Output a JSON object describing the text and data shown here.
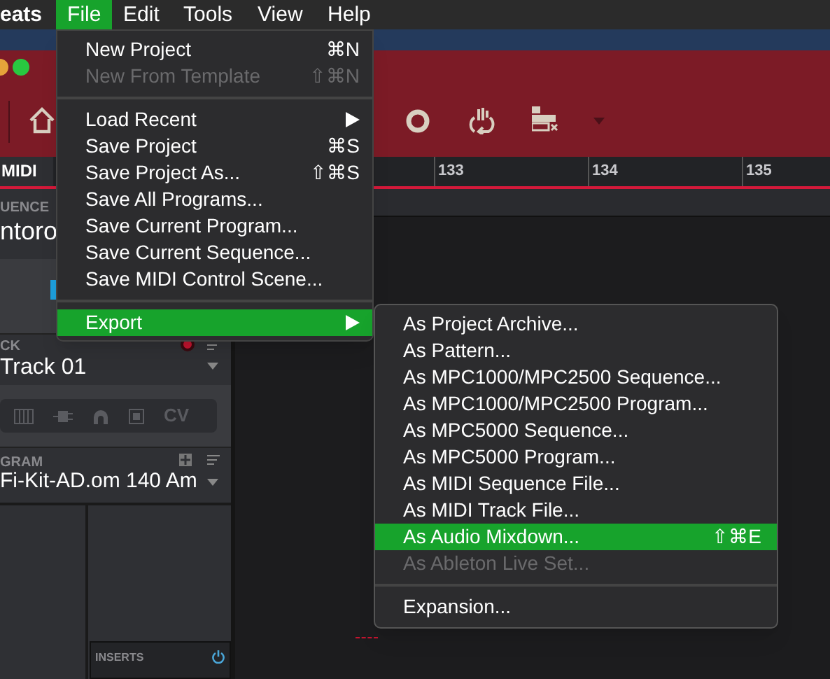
{
  "menu_bar": {
    "app_name": "eats",
    "menus": [
      {
        "label": "File",
        "selected": true
      },
      {
        "label": "Edit",
        "selected": false
      },
      {
        "label": "Tools",
        "selected": false
      },
      {
        "label": "View",
        "selected": false
      },
      {
        "label": "Help",
        "selected": false
      }
    ]
  },
  "ruler": {
    "tab": "MIDI",
    "marks": [
      "133",
      "134",
      "135"
    ]
  },
  "sequence_panel": {
    "label": "UENCE",
    "name": "ntoro"
  },
  "track_panel": {
    "label": "CK",
    "name": "Track 01",
    "mode_label": "CV"
  },
  "program_panel": {
    "label": "GRAM",
    "name": "Fi-Kit-AD.om 140 Am"
  },
  "inserts_panel": {
    "label": "INSERTS"
  },
  "file_menu": {
    "items": [
      {
        "kind": "item",
        "label": "New Project",
        "shortcut": "⌘N",
        "disabled": false,
        "selected": false
      },
      {
        "kind": "item",
        "label": "New From Template",
        "shortcut": "⇧⌘N",
        "disabled": true,
        "selected": false
      },
      {
        "kind": "separator"
      },
      {
        "kind": "submenu",
        "label": "Load Recent",
        "disabled": false,
        "selected": false
      },
      {
        "kind": "item",
        "label": "Save Project",
        "shortcut": "⌘S",
        "disabled": false,
        "selected": false
      },
      {
        "kind": "item",
        "label": "Save Project As...",
        "shortcut": "⇧⌘S",
        "disabled": false,
        "selected": false
      },
      {
        "kind": "item",
        "label": "Save All Programs...",
        "disabled": false,
        "selected": false
      },
      {
        "kind": "item",
        "label": "Save Current Program...",
        "disabled": false,
        "selected": false
      },
      {
        "kind": "item",
        "label": "Save Current Sequence...",
        "disabled": false,
        "selected": false
      },
      {
        "kind": "item",
        "label": "Save MIDI Control Scene...",
        "disabled": false,
        "selected": false
      },
      {
        "kind": "separator"
      },
      {
        "kind": "submenu",
        "label": "Export",
        "disabled": false,
        "selected": true
      }
    ]
  },
  "export_submenu": {
    "items": [
      {
        "kind": "item",
        "label": "As Project Archive...",
        "disabled": false,
        "selected": false
      },
      {
        "kind": "item",
        "label": "As Pattern...",
        "disabled": false,
        "selected": false
      },
      {
        "kind": "item",
        "label": "As MPC1000/MPC2500 Sequence...",
        "disabled": false,
        "selected": false
      },
      {
        "kind": "item",
        "label": "As MPC1000/MPC2500 Program...",
        "disabled": false,
        "selected": false
      },
      {
        "kind": "item",
        "label": "As MPC5000 Sequence...",
        "disabled": false,
        "selected": false
      },
      {
        "kind": "item",
        "label": "As MPC5000 Program...",
        "disabled": false,
        "selected": false
      },
      {
        "kind": "item",
        "label": "As MIDI Sequence File...",
        "disabled": false,
        "selected": false
      },
      {
        "kind": "item",
        "label": "As MIDI Track File...",
        "disabled": false,
        "selected": false
      },
      {
        "kind": "item",
        "label": "As Audio Mixdown...",
        "shortcut": "⇧⌘E",
        "disabled": false,
        "selected": true
      },
      {
        "kind": "item",
        "label": "As Ableton Live Set...",
        "disabled": true,
        "selected": false
      },
      {
        "kind": "separator"
      },
      {
        "kind": "item",
        "label": "Expansion...",
        "disabled": false,
        "selected": false
      }
    ]
  }
}
